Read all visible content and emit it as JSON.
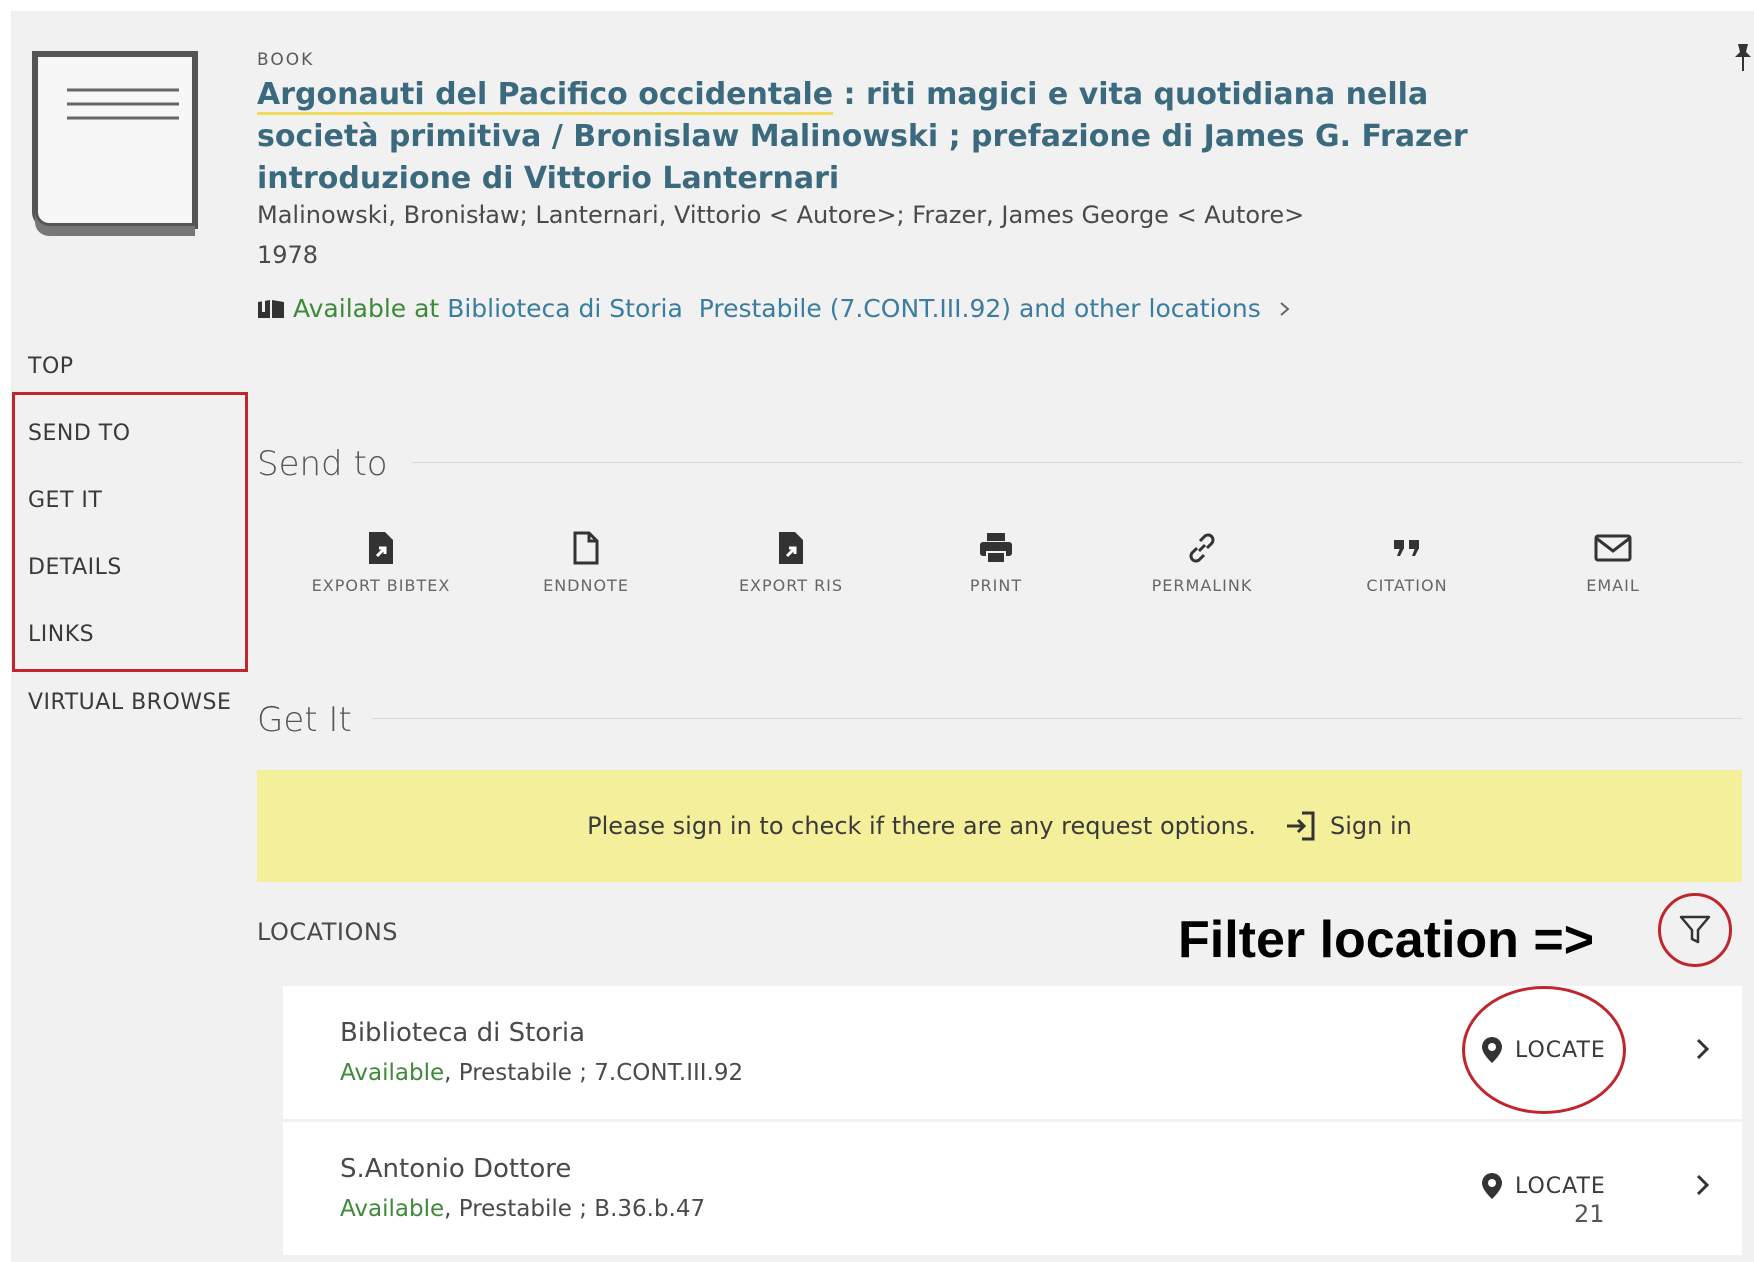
{
  "record": {
    "type": "BOOK",
    "title_part1": "Argonauti del Pacifico occidentale",
    "title_part2": " : riti magici e vita quotidiana nella società primitiva / Bronislaw Malinowski ; prefazione di James G. Frazer introduzione di Vittorio Lanternari",
    "authors": "Malinowski, Bronisław; Lanternari, Vittorio < Autore>; Frazer, James George < Autore>",
    "year": "1978",
    "availability": {
      "prefix": "Available at",
      "library": "Biblioteca di Storia",
      "detail": "Prestabile (7.CONT.III.92) and other locations"
    }
  },
  "sidenav": [
    "TOP",
    "SEND TO",
    "GET IT",
    "DETAILS",
    "LINKS",
    "VIRTUAL BROWSE"
  ],
  "send_to": {
    "heading": "Send to",
    "actions": [
      "EXPORT BIBTEX",
      "ENDNOTE",
      "EXPORT RIS",
      "PRINT",
      "PERMALINK",
      "CITATION",
      "EMAIL"
    ]
  },
  "get_it": {
    "heading": "Get It",
    "banner_text": "Please sign in to check if there are any request options.",
    "sign_in": "Sign in"
  },
  "locations": {
    "heading": "LOCATIONS",
    "annotation": "Filter location =>",
    "items": [
      {
        "name": "Biblioteca di Storia",
        "status": "Available",
        "detail": ", Prestabile ; 7.CONT.III.92",
        "action": "LOCATE"
      },
      {
        "name": "S.Antonio Dottore",
        "status": "Available",
        "detail": ", Prestabile ; B.36.b.47",
        "action": "LOCATE"
      }
    ]
  },
  "page_number": "21",
  "colors": {
    "link": "#3b6a7f",
    "available": "#3f8a3a",
    "banner": "#f4ef9b",
    "annotation": "#c0262d"
  }
}
